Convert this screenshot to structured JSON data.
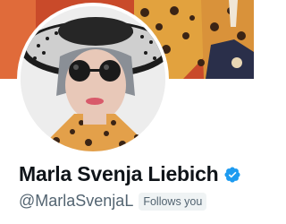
{
  "profile": {
    "display_name": "Marla Svenja Liebich",
    "handle": "@MarlaSvenjaL",
    "follows_you_label": "Follows you",
    "verified": true
  },
  "colors": {
    "verified_badge": "#1d9bf0",
    "name_text": "#0f1419",
    "secondary_text": "#536471",
    "chip_background": "#eff3f4",
    "banner_orange": "#d9542c",
    "banner_gold": "#e3a53c"
  },
  "icons": {
    "verified": "verified-badge-icon"
  }
}
